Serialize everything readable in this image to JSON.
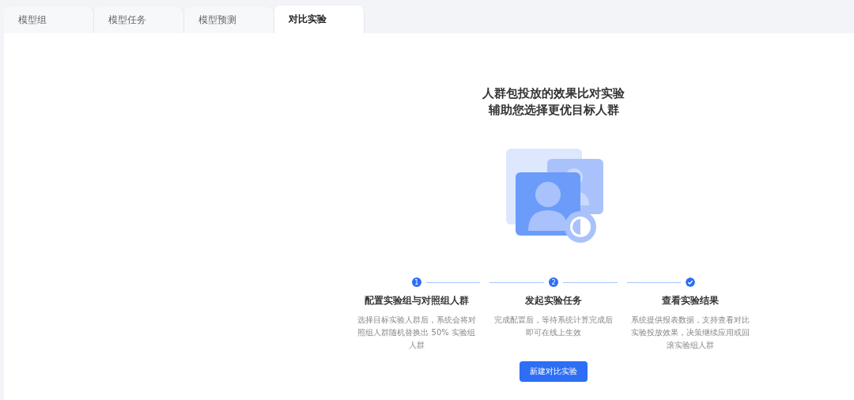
{
  "tabs": [
    {
      "label": "模型组",
      "selected": false
    },
    {
      "label": "模型任务",
      "selected": false
    },
    {
      "label": "模型预测",
      "selected": false
    },
    {
      "label": "对比实验",
      "selected": true
    }
  ],
  "intro": {
    "title_lines": [
      "人群包投放的效果比对实验",
      "辅助您选择更优目标人群"
    ]
  },
  "steps": [
    {
      "kind": "number",
      "marker": "1",
      "title": "配置实验组与对照组人群",
      "description": "选择目标实验人群后，系统会将对照组人群随机替换出 50% 实验组人群"
    },
    {
      "kind": "number",
      "marker": "2",
      "title": "发起实验任务",
      "description": "完成配置后，等待系统计算完成后即可在线上生效"
    },
    {
      "kind": "done",
      "title": "查看实验结果",
      "description": "系统提供报表数据，支持查看对比实验投放效果，决策继续应用或回滚实验组人群"
    }
  ],
  "primary_button": "新建对比实验"
}
